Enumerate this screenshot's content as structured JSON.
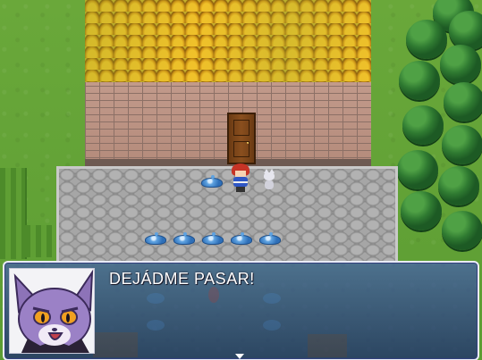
{
  "dialogue": {
    "text": "DEJÁDME PASAR!",
    "speaker_portrait": "purple-cat-face",
    "advance_indicator": "down-arrow-icon"
  },
  "scene": {
    "house_door": "wooden-door",
    "hero": "red-haired-hero",
    "npc": "white-cat",
    "enemies": [
      "blue-slime",
      "blue-slime",
      "blue-slime",
      "blue-slime",
      "blue-slime",
      "blue-slime"
    ]
  },
  "colors": {
    "window_fill": "#3c4fa0",
    "window_border": "#e9ecf6",
    "text": "#ffffff",
    "slime": "#4a8fd6"
  }
}
